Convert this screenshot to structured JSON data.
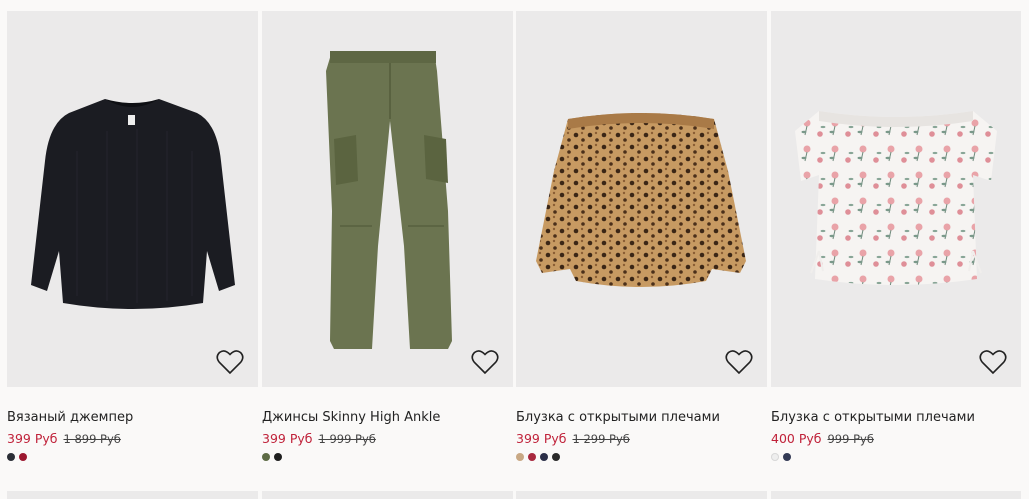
{
  "products": [
    {
      "title": "Вязаный джемпер",
      "price": "399 Руб",
      "old_price": "1 899 Руб",
      "colors": [
        "#2b2e36",
        "#9c1830"
      ],
      "image": "black-knit-sweater"
    },
    {
      "title": "Джинсы Skinny High Ankle",
      "price": "399 Руб",
      "old_price": "1 999 Руб",
      "colors": [
        "#5d6b45",
        "#1f1f1f"
      ],
      "image": "khaki-cargo-jeans"
    },
    {
      "title": "Блузка с открытыми плечами",
      "price": "399 Руб",
      "old_price": "1 299 Руб",
      "colors": [
        "#c8a884",
        "#a8283e",
        "#2b2f48",
        "#2a2a2a"
      ],
      "image": "leopard-off-shoulder-blouse"
    },
    {
      "title": "Блузка с открытыми плечами",
      "price": "400 Руб",
      "old_price": "999 Руб",
      "colors": [
        "#eeeeee",
        "#333a55"
      ],
      "image": "floral-off-shoulder-blouse"
    }
  ],
  "icons": {
    "favorite": "heart-outline-icon"
  },
  "theme": {
    "sale_color": "#c0223a",
    "background": "#faf9f8",
    "image_bg": "#ebeaea"
  }
}
